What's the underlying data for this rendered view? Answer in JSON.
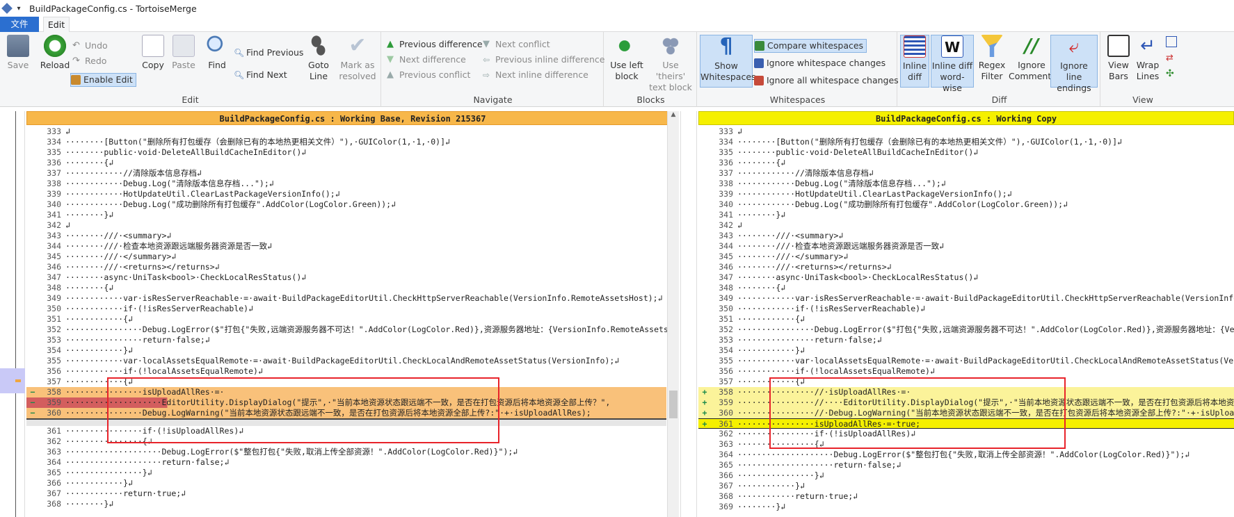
{
  "window": {
    "title": "BuildPackageConfig.cs - TortoiseMerge"
  },
  "tabs": {
    "file": "文件",
    "edit": "Edit"
  },
  "ribbon": {
    "edit_group": {
      "label": "Edit",
      "save": "Save",
      "reload": "Reload",
      "undo": "Undo",
      "redo": "Redo",
      "enable_edit": "Enable Edit",
      "copy": "Copy",
      "paste": "Paste",
      "find": "Find",
      "find_previous": "Find Previous",
      "find_next": "Find Next",
      "goto_line_1": "Goto",
      "goto_line_2": "Line",
      "mark_1": "Mark as",
      "mark_2": "resolved"
    },
    "navigate_group": {
      "label": "Navigate",
      "prev_diff": "Previous difference",
      "next_diff": "Next difference",
      "prev_conflict": "Previous conflict",
      "next_conflict": "Next conflict",
      "prev_inline": "Previous inline difference",
      "next_inline": "Next inline difference"
    },
    "blocks_group": {
      "label": "Blocks",
      "use_left_1": "Use left",
      "use_left_2": "block",
      "use_theirs_1": "Use 'theirs'",
      "use_theirs_2": "text block"
    },
    "whitespaces_group": {
      "label": "Whitespaces",
      "show_ws_1": "Show",
      "show_ws_2": "Whitespaces",
      "compare_ws": "Compare whitespaces",
      "ignore_ws_changes": "Ignore whitespace changes",
      "ignore_all_ws": "Ignore all whitespace changes"
    },
    "diff_group": {
      "label": "Diff",
      "inline_1": "Inline",
      "inline_2": "diff",
      "inline_word_1": "Inline diff",
      "inline_word_2": "word-wise",
      "regex_1": "Regex",
      "regex_2": "Filter",
      "ignore_comments_1": "Ignore",
      "ignore_comments_2": "Comments",
      "ignore_endings_1": "Ignore line",
      "ignore_endings_2": "endings"
    },
    "view_group": {
      "label": "View",
      "view_bars_1": "View",
      "view_bars_2": "Bars",
      "wrap_1": "Wrap",
      "wrap_2": "Lines"
    }
  },
  "left_panel": {
    "header": "BuildPackageConfig.cs : Working Base, Revision 215367",
    "lines": [
      {
        "n": "333",
        "t": "↲",
        "s": "n"
      },
      {
        "n": "334",
        "t": "········[Button(\"删除所有打包缓存（会删除已有的本地热更相关文件）\"),·GUIColor(1,·1,·0)]↲",
        "s": "n"
      },
      {
        "n": "335",
        "t": "········public·void·DeleteAllBuildCacheInEditor()↲",
        "s": "n"
      },
      {
        "n": "336",
        "t": "········{↲",
        "s": "n"
      },
      {
        "n": "337",
        "t": "············//清除版本信息存档↲",
        "s": "n"
      },
      {
        "n": "338",
        "t": "············Debug.Log(\"清除版本信息存档...\");↲",
        "s": "n"
      },
      {
        "n": "339",
        "t": "············HotUpdateUtil.ClearLastPackageVersionInfo();↲",
        "s": "n"
      },
      {
        "n": "340",
        "t": "············Debug.Log(\"成功删除所有打包缓存\".AddColor(LogColor.Green));↲",
        "s": "n"
      },
      {
        "n": "341",
        "t": "········}↲",
        "s": "n"
      },
      {
        "n": "342",
        "t": "↲",
        "s": "n"
      },
      {
        "n": "343",
        "t": "········///·<summary>↲",
        "s": "n"
      },
      {
        "n": "344",
        "t": "········///·检查本地资源跟远端服务器资源是否一致↲",
        "s": "n"
      },
      {
        "n": "345",
        "t": "········///·</summary>↲",
        "s": "n"
      },
      {
        "n": "346",
        "t": "········///·<returns></returns>↲",
        "s": "n"
      },
      {
        "n": "347",
        "t": "········async·UniTask<bool>·CheckLocalResStatus()↲",
        "s": "n"
      },
      {
        "n": "348",
        "t": "········{↲",
        "s": "n"
      },
      {
        "n": "349",
        "t": "············var·isResServerReachable·=·await·BuildPackageEditorUtil.CheckHttpServerReachable(VersionInfo.RemoteAssetsHost);↲",
        "s": "n"
      },
      {
        "n": "350",
        "t": "············if·(!isResServerReachable)↲",
        "s": "n"
      },
      {
        "n": "351",
        "t": "············{↲",
        "s": "n"
      },
      {
        "n": "352",
        "t": "················Debug.LogError($\"打包{\"失败,远端资源服务器不可达！\".AddColor(LogColor.Red)},资源服务器地址：{VersionInfo.RemoteAssetsHost}\");",
        "s": "n"
      },
      {
        "n": "353",
        "t": "················return·false;↲",
        "s": "n"
      },
      {
        "n": "354",
        "t": "············}↲",
        "s": "n"
      },
      {
        "n": "355",
        "t": "············var·localAssetsEqualRemote·=·await·BuildPackageEditorUtil.CheckLocalAndRemoteAssetStatus(VersionInfo);↲",
        "s": "n"
      },
      {
        "n": "356",
        "t": "············if·(!localAssetsEqualRemote)↲",
        "s": "n"
      },
      {
        "n": "357",
        "t": "············{↲",
        "s": "n"
      },
      {
        "n": "358",
        "t": "················isUploadAllRes·=·",
        "s": "del",
        "m": "−"
      },
      {
        "n": "359",
        "t": "····················EditorUtility.DisplayDialog(\"提示\",·\"当前本地资源状态跟远端不一致，是否在打包资源后将本地资源全部上传？\",",
        "s": "del2",
        "m": "−"
      },
      {
        "n": "360",
        "t": "················Debug.LogWarning(\"当前本地资源状态跟远端不一致，是否在打包资源后将本地资源全部上传?:\"·+·isUploadAllRes);",
        "s": "del",
        "m": "−"
      },
      {
        "n": "",
        "t": "",
        "s": "gap"
      },
      {
        "n": "361",
        "t": "················if·(!isUploadAllRes)↲",
        "s": "n"
      },
      {
        "n": "362",
        "t": "················{↲",
        "s": "n"
      },
      {
        "n": "363",
        "t": "····················Debug.LogError($\"整包打包{\"失败,取消上传全部资源！\".AddColor(LogColor.Red)}\");↲",
        "s": "n"
      },
      {
        "n": "364",
        "t": "····················return·false;↲",
        "s": "n"
      },
      {
        "n": "365",
        "t": "················}↲",
        "s": "n"
      },
      {
        "n": "366",
        "t": "············}↲",
        "s": "n"
      },
      {
        "n": "367",
        "t": "············return·true;↲",
        "s": "n"
      },
      {
        "n": "368",
        "t": "········}↲",
        "s": "n"
      }
    ]
  },
  "right_panel": {
    "header": "BuildPackageConfig.cs : Working Copy",
    "lines": [
      {
        "n": "333",
        "t": "↲",
        "s": "n"
      },
      {
        "n": "334",
        "t": "········[Button(\"删除所有打包缓存（会删除已有的本地热更相关文件）\"),·GUIColor(1,·1,·0)]↲",
        "s": "n"
      },
      {
        "n": "335",
        "t": "········public·void·DeleteAllBuildCacheInEditor()↲",
        "s": "n"
      },
      {
        "n": "336",
        "t": "········{↲",
        "s": "n"
      },
      {
        "n": "337",
        "t": "············//清除版本信息存档↲",
        "s": "n"
      },
      {
        "n": "338",
        "t": "············Debug.Log(\"清除版本信息存档...\");↲",
        "s": "n"
      },
      {
        "n": "339",
        "t": "············HotUpdateUtil.ClearLastPackageVersionInfo();↲",
        "s": "n"
      },
      {
        "n": "340",
        "t": "············Debug.Log(\"成功删除所有打包缓存\".AddColor(LogColor.Green));↲",
        "s": "n"
      },
      {
        "n": "341",
        "t": "········}↲",
        "s": "n"
      },
      {
        "n": "342",
        "t": "↲",
        "s": "n"
      },
      {
        "n": "343",
        "t": "········///·<summary>↲",
        "s": "n"
      },
      {
        "n": "344",
        "t": "········///·检查本地资源跟远端服务器资源是否一致↲",
        "s": "n"
      },
      {
        "n": "345",
        "t": "········///·</summary>↲",
        "s": "n"
      },
      {
        "n": "346",
        "t": "········///·<returns></returns>↲",
        "s": "n"
      },
      {
        "n": "347",
        "t": "········async·UniTask<bool>·CheckLocalResStatus()↲",
        "s": "n"
      },
      {
        "n": "348",
        "t": "········{↲",
        "s": "n"
      },
      {
        "n": "349",
        "t": "············var·isResServerReachable·=·await·BuildPackageEditorUtil.CheckHttpServerReachable(VersionInfo.RemoteAssetsHost);↲",
        "s": "n"
      },
      {
        "n": "350",
        "t": "············if·(!isResServerReachable)↲",
        "s": "n"
      },
      {
        "n": "351",
        "t": "············{↲",
        "s": "n"
      },
      {
        "n": "352",
        "t": "················Debug.LogError($\"打包{\"失败,远端资源服务器不可达！\".AddColor(LogColor.Red)},资源服务器地址：{VersionInfo.RemoteAssetsHost}\");",
        "s": "n"
      },
      {
        "n": "353",
        "t": "················return·false;↲",
        "s": "n"
      },
      {
        "n": "354",
        "t": "············}↲",
        "s": "n"
      },
      {
        "n": "355",
        "t": "············var·localAssetsEqualRemote·=·await·BuildPackageEditorUtil.CheckLocalAndRemoteAssetStatus(VersionInfo);↲",
        "s": "n"
      },
      {
        "n": "356",
        "t": "············if·(!localAssetsEqualRemote)↲",
        "s": "n"
      },
      {
        "n": "357",
        "t": "············{↲",
        "s": "n"
      },
      {
        "n": "358",
        "t": "················//·isUploadAllRes·=·",
        "s": "add",
        "m": "+"
      },
      {
        "n": "359",
        "t": "················//····EditorUtility.DisplayDialog(\"提示\",·\"当前本地资源状态跟远端不一致，是否在打包资源后将本地资源全部上传？\",",
        "s": "add",
        "m": "+"
      },
      {
        "n": "360",
        "t": "················//·Debug.LogWarning(\"当前本地资源状态跟远端不一致，是否在打包资源后将本地资源全部上传?:\"·+·isUploadAllRes);",
        "s": "add",
        "m": "+"
      },
      {
        "n": "361",
        "t": "················isUploadAllRes·=·true;",
        "s": "cur",
        "m": "+"
      },
      {
        "n": "362",
        "t": "················if·(!isUploadAllRes)↲",
        "s": "n"
      },
      {
        "n": "363",
        "t": "················{↲",
        "s": "n"
      },
      {
        "n": "364",
        "t": "····················Debug.LogError($\"整包打包{\"失败,取消上传全部资源！\".AddColor(LogColor.Red)}\");↲",
        "s": "n"
      },
      {
        "n": "365",
        "t": "····················return·false;↲",
        "s": "n"
      },
      {
        "n": "366",
        "t": "················}↲",
        "s": "n"
      },
      {
        "n": "367",
        "t": "············}↲",
        "s": "n"
      },
      {
        "n": "368",
        "t": "············return·true;↲",
        "s": "n"
      },
      {
        "n": "369",
        "t": "········}↲",
        "s": "n"
      }
    ]
  },
  "colors": {
    "left_header": "#f7b74a",
    "right_header": "#f5f000",
    "deleted": "#f9c17a",
    "deleted_strong": "#d35e5e",
    "added": "#fbf39a",
    "current_line": "#f5f000",
    "marker_green": "#1a8a4a",
    "annotation_red": "#e8232a",
    "selected": "#cde1f7"
  }
}
